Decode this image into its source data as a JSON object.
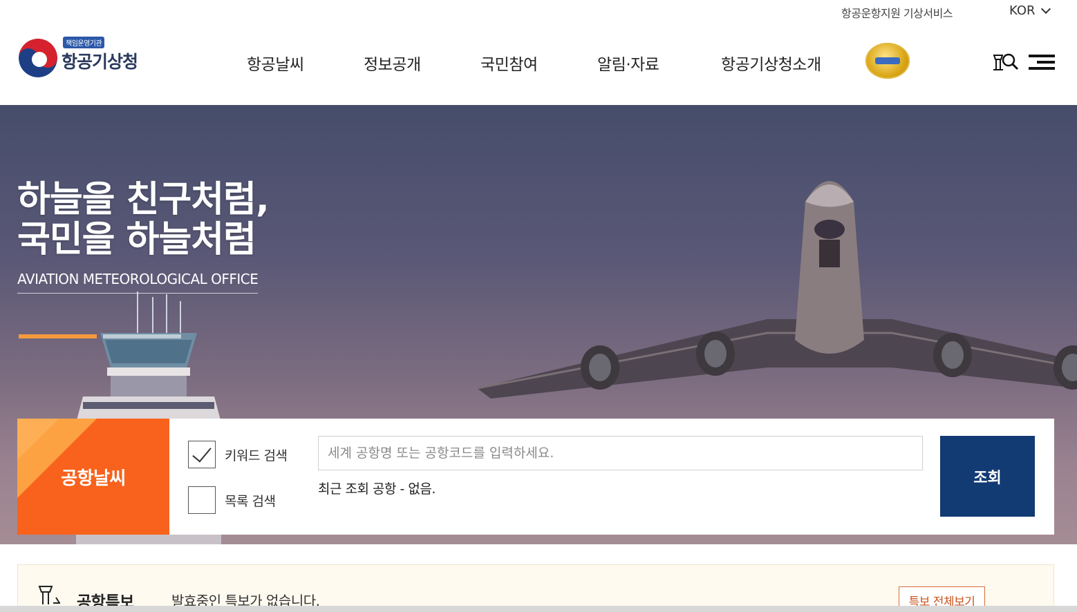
{
  "utility": {
    "service_link": "항공운항지원 기상서비스",
    "language": "KOR"
  },
  "header": {
    "logo_badge": "책임운영기관",
    "logo_name": "항공기상청",
    "nav": [
      "항공날씨",
      "정보공개",
      "국민참여",
      "알림·자료",
      "항공기상청소개"
    ],
    "seal_icon": "certification-seal-icon",
    "search_icon": "airport-search-icon",
    "menu_icon": "hamburger-menu-icon"
  },
  "hero": {
    "title_line1": "하늘을 친구처럼,",
    "title_line2": "국민을 하늘처럼",
    "subtitle": "AVIATION METEOROLOGICAL OFFICE",
    "slides_active_index": 0
  },
  "airport_search": {
    "label": "공항날씨",
    "options": [
      {
        "label": "키워드 검색",
        "checked": true
      },
      {
        "label": "목록 검색",
        "checked": false
      }
    ],
    "placeholder": "세계 공항명 또는 공항코드를 입력하세요.",
    "value": "",
    "recent": "최근 조회 공항 - 없음.",
    "submit_label": "조회"
  },
  "notice": {
    "title": "공항특보",
    "message": "발효중인 특보가 없습니다.",
    "button_label": "특보 전체보기"
  },
  "colors": {
    "accent_orange": "#f8621c",
    "navy": "#123a73",
    "slider_active": "#f49a3c"
  }
}
